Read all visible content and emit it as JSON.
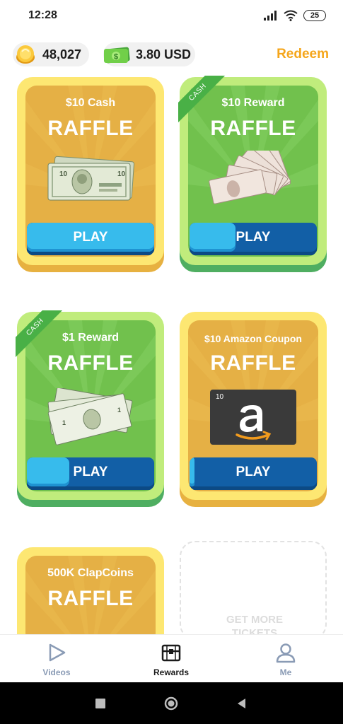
{
  "status": {
    "time": "12:28",
    "battery": "25"
  },
  "header": {
    "coins": "48,027",
    "cash": "3.80 USD",
    "redeem_label": "Redeem"
  },
  "cards": [
    {
      "title": "$10 Cash",
      "subtitle": "RAFFLE",
      "play_label": "PLAY",
      "ribbon": "",
      "progress": 1.0,
      "theme": "yellow"
    },
    {
      "title": "$10 Reward",
      "subtitle": "RAFFLE",
      "play_label": "PLAY",
      "ribbon": "CASH",
      "progress": 0.36,
      "theme": "green"
    },
    {
      "title": "$1 Reward",
      "subtitle": "RAFFLE",
      "play_label": "PLAY",
      "ribbon": "CASH",
      "progress": 0.33,
      "theme": "green"
    },
    {
      "title": "$10 Amazon Coupon",
      "subtitle": "RAFFLE",
      "play_label": "PLAY",
      "ribbon": "",
      "progress": 0.03,
      "theme": "yellow",
      "gift_card_value": "10"
    },
    {
      "title": "500K ClapCoins",
      "subtitle": "RAFFLE",
      "play_label": "",
      "ribbon": "",
      "theme": "yellow"
    }
  ],
  "get_more": {
    "line1": "GET MORE",
    "line2": "TICKETS"
  },
  "nav": {
    "items": [
      {
        "label": "Videos",
        "icon": "play-triangle-icon",
        "active": false
      },
      {
        "label": "Rewards",
        "icon": "treasure-chest-icon",
        "active": true
      },
      {
        "label": "Me",
        "icon": "person-icon",
        "active": false
      }
    ]
  },
  "colors": {
    "accent": "#f5a61b",
    "play_blue": "#125fa6",
    "play_fill": "#37bbec",
    "card_yellow": "#e5b045",
    "card_green": "#71c14d"
  }
}
